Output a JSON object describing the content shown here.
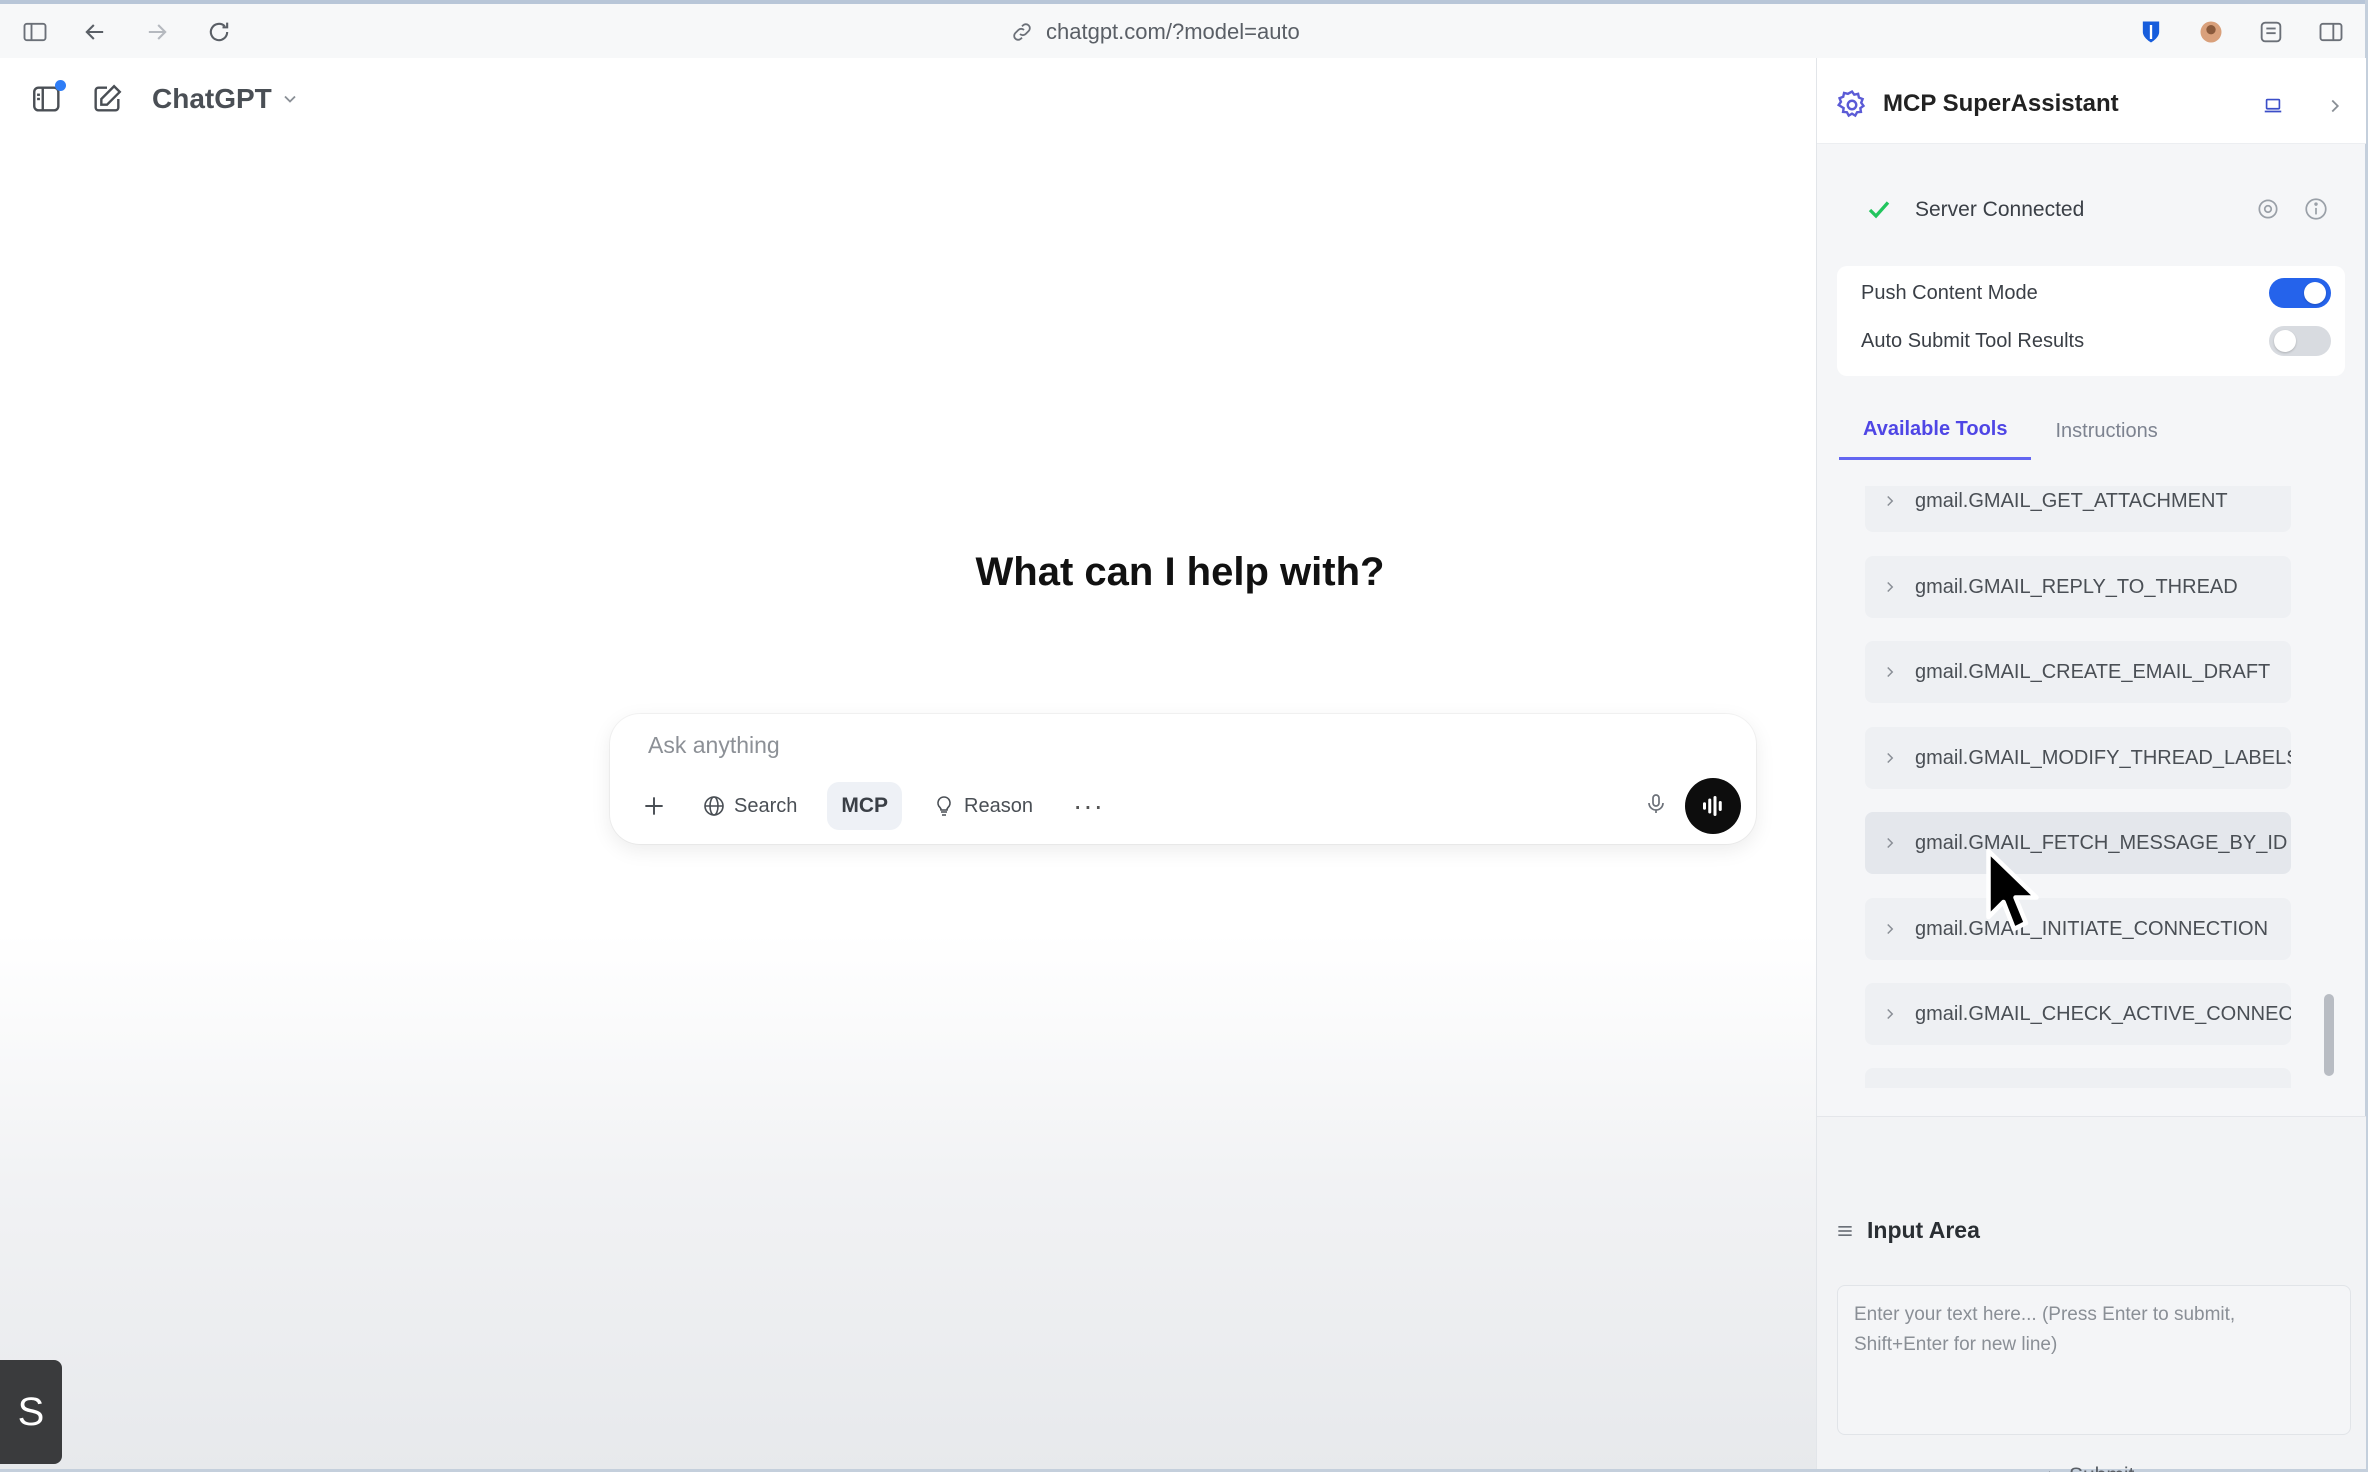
{
  "browser": {
    "url": "chatgpt.com/?model=auto"
  },
  "chat": {
    "model_name": "ChatGPT",
    "headline": "What can I help with?",
    "composer": {
      "placeholder": "Ask anything",
      "search_label": "Search",
      "mcp_label": "MCP",
      "reason_label": "Reason",
      "more_label": "···"
    }
  },
  "overlay_badge": "S",
  "sidebar": {
    "title": "MCP SuperAssistant",
    "status": "Server Connected",
    "toggles": [
      {
        "label": "Push Content Mode",
        "on": true
      },
      {
        "label": "Auto Submit Tool Results",
        "on": false
      }
    ],
    "tabs": [
      "Available Tools",
      "Instructions"
    ],
    "active_tab": "Available Tools",
    "tools": [
      "gmail.GMAIL_GET_ATTACHMENT",
      "gmail.GMAIL_REPLY_TO_THREAD",
      "gmail.GMAIL_CREATE_EMAIL_DRAFT",
      "gmail.GMAIL_MODIFY_THREAD_LABELS",
      "gmail.GMAIL_FETCH_MESSAGE_BY_ID",
      "gmail.GMAIL_INITIATE_CONNECTION",
      "gmail.GMAIL_CHECK_ACTIVE_CONNECTION"
    ],
    "input_area": {
      "title": "Input Area",
      "placeholder": "Enter your text here... (Press Enter to submit, Shift+Enter for new line)",
      "submit_label": "Submit"
    }
  },
  "colors": {
    "accent_blue": "#2563eb",
    "tab_active": "#4f46e5",
    "status_green": "#22c55e"
  }
}
